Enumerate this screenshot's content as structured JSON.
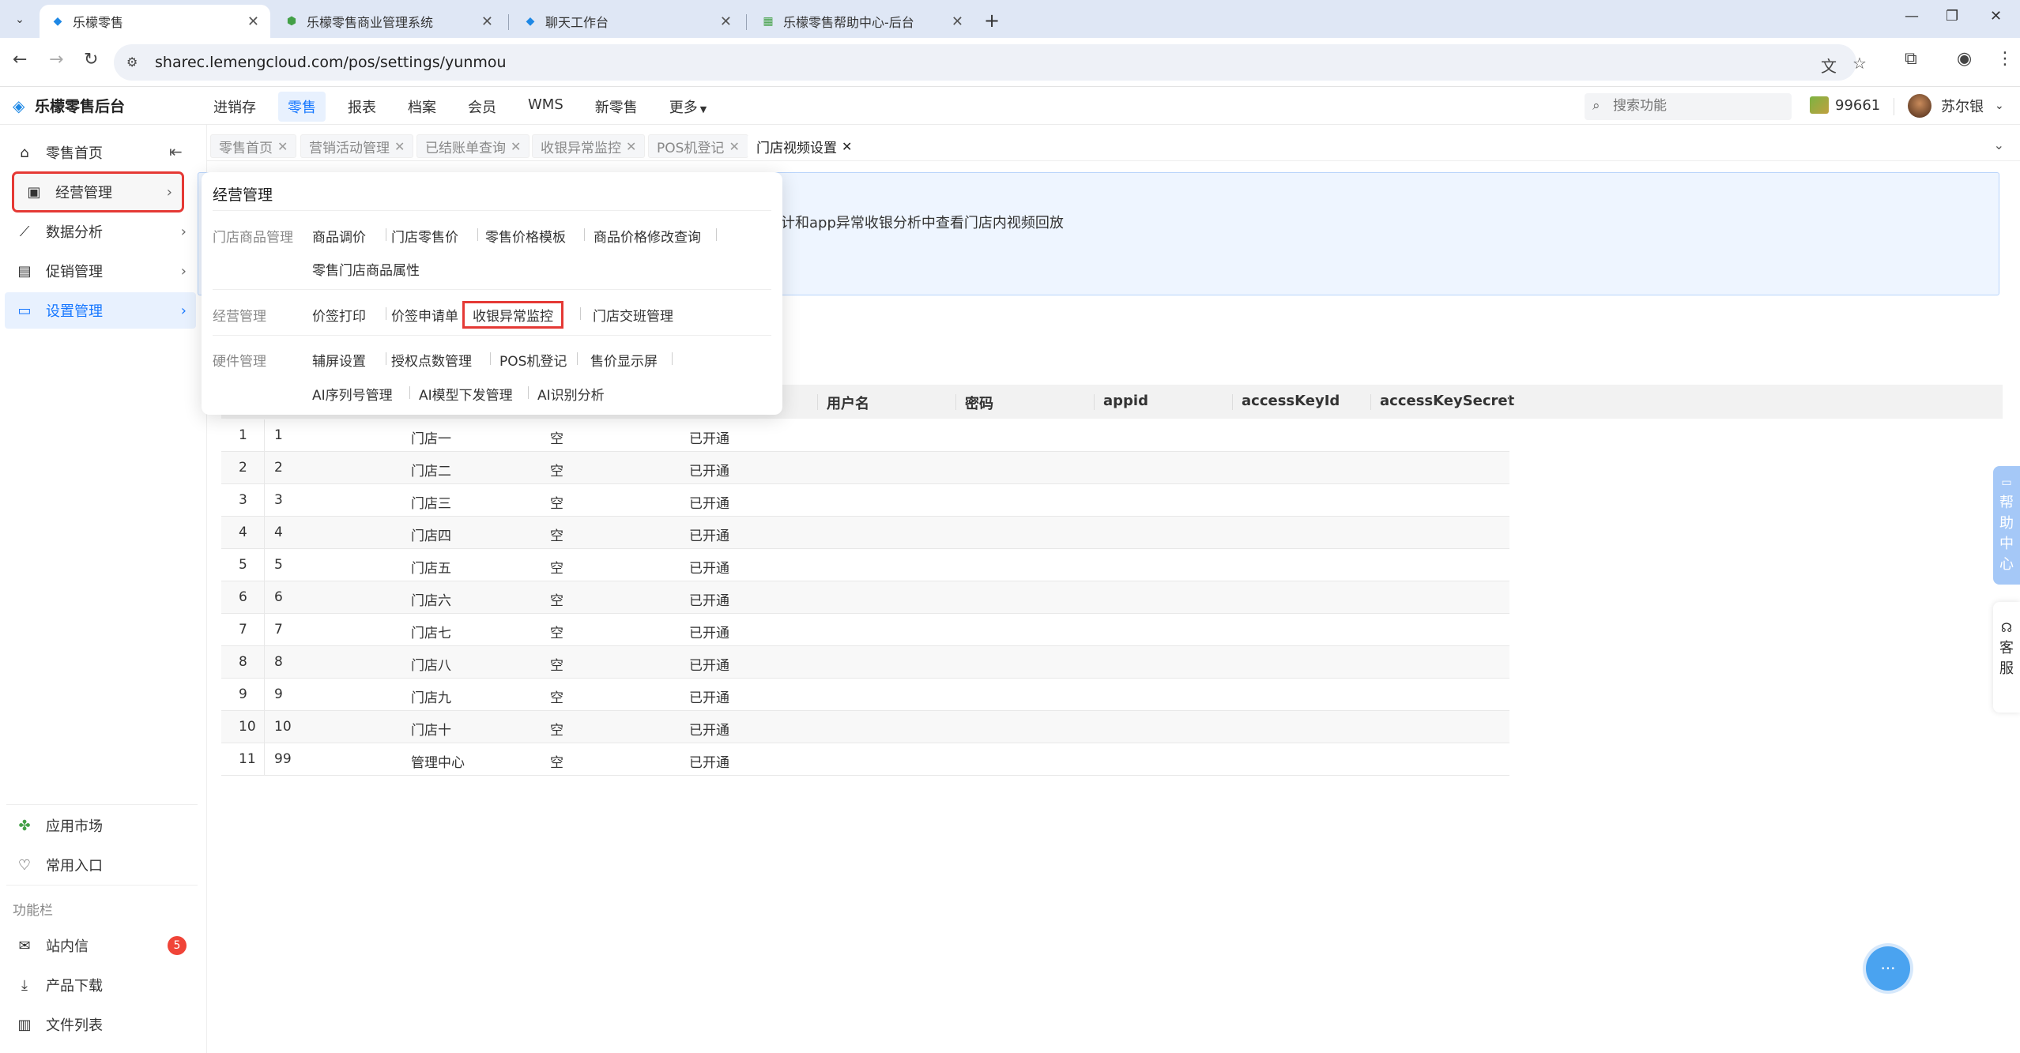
{
  "browser": {
    "tabs": [
      {
        "title": "乐檬零售",
        "active": true
      },
      {
        "title": "乐檬零售商业管理系统",
        "active": false
      },
      {
        "title": "聊天工作台",
        "active": false
      },
      {
        "title": "乐檬零售帮助中心-后台",
        "active": false
      }
    ],
    "url": "sharec.lemengcloud.com/pos/settings/yunmou"
  },
  "header": {
    "logo": "乐檬零售后台",
    "nav": [
      "进销存",
      "零售",
      "报表",
      "档案",
      "会员",
      "WMS",
      "新零售",
      "更多"
    ],
    "active_nav": "零售",
    "search_placeholder": "搜索功能",
    "points": "99661",
    "user_name": "苏尔银"
  },
  "sidebar": {
    "items": [
      {
        "label": "零售首页",
        "icon": "home-icon"
      },
      {
        "label": "经营管理",
        "icon": "chart-board-icon"
      },
      {
        "label": "数据分析",
        "icon": "line-chart-icon"
      },
      {
        "label": "促销管理",
        "icon": "promo-icon"
      },
      {
        "label": "设置管理",
        "icon": "folder-icon"
      }
    ],
    "bottom_items": [
      {
        "label": "应用市场",
        "icon": "app-market-icon"
      },
      {
        "label": "常用入口",
        "icon": "heart-icon"
      }
    ],
    "section_title": "功能栏",
    "function_items": [
      {
        "label": "站内信",
        "icon": "mail-icon",
        "badge": "5"
      },
      {
        "label": "产品下载",
        "icon": "download-icon"
      },
      {
        "label": "文件列表",
        "icon": "file-list-icon"
      }
    ]
  },
  "page_tabs": [
    {
      "label": "零售首页",
      "active": false
    },
    {
      "label": "营销活动管理",
      "active": false
    },
    {
      "label": "已结账单查询",
      "active": false
    },
    {
      "label": "收银异常监控",
      "active": false
    },
    {
      "label": "POS机登记",
      "active": false
    },
    {
      "label": "门店视频设置",
      "active": true
    }
  ],
  "notice_text": "计和app异常收银分析中查看门店内视频回放",
  "table": {
    "headers": [
      "用户名",
      "密码",
      "appid",
      "accessKeyId",
      "accessKeySecret"
    ],
    "rows": [
      {
        "no": "1",
        "code": "1",
        "store": "门店一",
        "x": "空",
        "status": "已开通"
      },
      {
        "no": "2",
        "code": "2",
        "store": "门店二",
        "x": "空",
        "status": "已开通"
      },
      {
        "no": "3",
        "code": "3",
        "store": "门店三",
        "x": "空",
        "status": "已开通"
      },
      {
        "no": "4",
        "code": "4",
        "store": "门店四",
        "x": "空",
        "status": "已开通"
      },
      {
        "no": "5",
        "code": "5",
        "store": "门店五",
        "x": "空",
        "status": "已开通"
      },
      {
        "no": "6",
        "code": "6",
        "store": "门店六",
        "x": "空",
        "status": "已开通"
      },
      {
        "no": "7",
        "code": "7",
        "store": "门店七",
        "x": "空",
        "status": "已开通"
      },
      {
        "no": "8",
        "code": "8",
        "store": "门店八",
        "x": "空",
        "status": "已开通"
      },
      {
        "no": "9",
        "code": "9",
        "store": "门店九",
        "x": "空",
        "status": "已开通"
      },
      {
        "no": "10",
        "code": "10",
        "store": "门店十",
        "x": "空",
        "status": "已开通"
      },
      {
        "no": "11",
        "code": "99",
        "store": "管理中心",
        "x": "空",
        "status": "已开通"
      }
    ]
  },
  "mega_menu": {
    "title": "经营管理",
    "groups": [
      {
        "label": "门店商品管理",
        "links": [
          "商品调价",
          "门店零售价",
          "零售价格模板",
          "商品价格修改查询",
          "零售门店商品属性"
        ]
      },
      {
        "label": "经营管理",
        "links": [
          "价签打印",
          "价签申请单",
          "收银异常监控",
          "门店交班管理"
        ]
      },
      {
        "label": "硬件管理",
        "links": [
          "辅屏设置",
          "授权点数管理",
          "POS机登记",
          "售价显示屏",
          "AI序列号管理",
          "AI模型下发管理",
          "AI识别分析"
        ]
      }
    ],
    "highlighted_link": "收银异常监控"
  },
  "float": {
    "help_center": "帮助中心",
    "customer_service": "客服"
  },
  "colors": {
    "accent": "#1677ff",
    "highlight_box": "#e53935",
    "badge": "#f04438"
  }
}
